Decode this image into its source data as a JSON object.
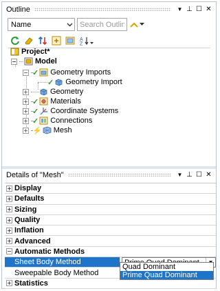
{
  "outline": {
    "title": "Outline",
    "buttons": {
      "dropdown": "▼",
      "pin": "⊥",
      "restore": "☐",
      "close": "✕"
    },
    "filter_select": "Name",
    "search_placeholder": "Search Outline",
    "tree": [
      {
        "label": "Project*"
      },
      {
        "label": "Model"
      },
      {
        "label": "Geometry Imports"
      },
      {
        "label": "Geometry Import"
      },
      {
        "label": "Geometry"
      },
      {
        "label": "Materials"
      },
      {
        "label": "Coordinate Systems"
      },
      {
        "label": "Connections"
      },
      {
        "label": "Mesh"
      }
    ]
  },
  "details": {
    "title": "Details of \"Mesh\"",
    "buttons": {
      "dropdown": "▼",
      "pin": "⊥",
      "restore": "☐",
      "close": "✕"
    },
    "groups": [
      {
        "label": "Display",
        "toggle": "+"
      },
      {
        "label": "Defaults",
        "toggle": "+"
      },
      {
        "label": "Sizing",
        "toggle": "+"
      },
      {
        "label": "Quality",
        "toggle": "+"
      },
      {
        "label": "Inflation",
        "toggle": "+"
      },
      {
        "label": "Advanced",
        "toggle": "+"
      },
      {
        "label": "Automatic Methods",
        "toggle": "−"
      }
    ],
    "automatic_methods": {
      "sheet_body_method": {
        "label": "Sheet Body Method",
        "value": "Prime Quad Dominant"
      },
      "sweepable_body_method": {
        "label": "Sweepable Body Method"
      }
    },
    "statistics": {
      "label": "Statistics",
      "toggle": "+"
    },
    "dropdown_options": [
      "Quad Dominant",
      "Prime Quad Dominant"
    ]
  },
  "colors": {
    "selection": "#1e74c9",
    "check": "#2d9d2d",
    "bolt": "#d9a600"
  }
}
